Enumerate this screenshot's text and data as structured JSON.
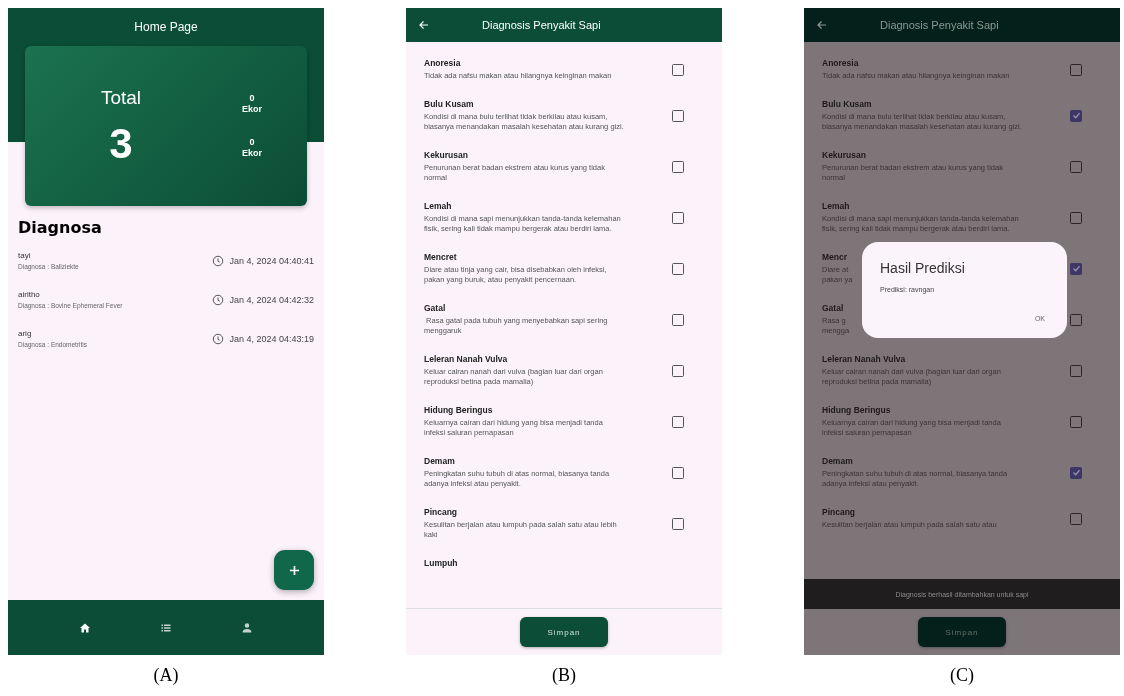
{
  "home_screen": {
    "title": "Home Page",
    "total_label": "Total",
    "total_value": "3",
    "stats": [
      {
        "value": "0",
        "unit": "Ekor"
      },
      {
        "value": "0",
        "unit": "Ekor"
      }
    ],
    "section_title": "Diagnosa",
    "diagnoses": [
      {
        "name": "tayi",
        "diagnosis": "Diagnosa : Ballziekte",
        "time": "Jan 4, 2024 04:40:41"
      },
      {
        "name": "airitho",
        "diagnosis": "Diagnosa : Bovine Ephemeral Fever",
        "time": "Jan 4, 2024 04:42:32"
      },
      {
        "name": "arig",
        "diagnosis": "Diagnosa : Endometritis",
        "time": "Jan 4, 2024 04:43:19"
      }
    ],
    "nav": [
      {
        "kind": "home",
        "selected": true
      },
      {
        "kind": "list",
        "selected": false
      },
      {
        "kind": "person",
        "selected": false
      }
    ]
  },
  "diagnosis_screen": {
    "title": "Diagnosis Penyakit Sapi",
    "symptoms": [
      {
        "title": "Anoresia",
        "desc": "Tidak ada nafsu makan atau hilangnya keinginan makan",
        "checked": false
      },
      {
        "title": "Bulu Kusam",
        "desc": "Kondisi di mana bulu terlihat tidak berkilau atau kusam, biasanya menandakan masalah kesehatan atau kurang gizi.",
        "checked": false
      },
      {
        "title": "Kekurusan",
        "desc": "Penurunan berat badan ekstrem atau kurus yang tidak normal",
        "checked": false
      },
      {
        "title": "Lemah",
        "desc": "Kondisi di mana sapi menunjukkan tanda-tanda kelemahan fisik, sering kali tidak mampu bergerak atau berdiri lama.",
        "checked": false
      },
      {
        "title": "Mencret",
        "desc": "Diare atau tinja yang cair, bisa disebabkan oleh infeksi, pakan yang buruk, atau penyakit pencernaan.",
        "checked": false
      },
      {
        "title": "Gatal",
        "desc": " Rasa gatal pada tubuh yang menyebabkan sapi sering menggaruk",
        "checked": false
      },
      {
        "title": "Leleran Nanah Vulva",
        "desc": "Keluar cairan nanah dari vulva (bagian luar dari organ reproduksi betina pada mamalia)",
        "checked": false
      },
      {
        "title": "Hidung Beringus",
        "desc": "Keluarnya cairan dari hidung yang bisa menjadi tanda infeksi saluran pernapasan",
        "checked": false
      },
      {
        "title": "Demam",
        "desc": "Peningkatan suhu tubuh di atas normal, biasanya tanda adanya infeksi atau penyakit.",
        "checked": false
      },
      {
        "title": "Pincang",
        "desc": "Kesulitan berjalan atau lumpuh pada salah satu atau lebih kaki",
        "checked": false
      },
      {
        "title": "Lumpuh"
      }
    ],
    "button": "Simpan"
  },
  "result_screen": {
    "title": "Diagnosis Penyakit Sapi",
    "symptoms": [
      {
        "title": "Anoresia",
        "desc": "Tidak ada nafsu makan atau hilangnya keinginan makan",
        "checked": false,
        "covered": false
      },
      {
        "title": "Bulu Kusam",
        "desc": "Kondisi di mana bulu terlihat tidak berkilau atau kusam, biasanya menandakan masalah kesehatan atau kurang gizi.",
        "checked": true,
        "covered": false
      },
      {
        "title": "Kekurusan",
        "desc": "Penurunan berat badan ekstrem atau kurus yang tidak normal",
        "checked": false,
        "covered": false
      },
      {
        "title": "Lemah",
        "desc": "Kondisi di mana sapi menunjukkan tanda-tanda kelemahan fisik, sering kali tidak mampu bergerak atau berdiri lama.",
        "checked": false,
        "covered": false
      },
      {
        "title": "Mencr",
        "desc": "Diare at pakan ya",
        "checked": true,
        "covered": true
      },
      {
        "title": "Gatal",
        "desc": "Rasa g mengga",
        "checked": false,
        "covered": true
      },
      {
        "title": "Leleran Nanah Vulva",
        "desc": "Keluar cairan nanah dari vulva (bagian luar dari organ reproduksi betina pada mamalia)",
        "checked": false,
        "covered": false
      },
      {
        "title": "Hidung Beringus",
        "desc": "Keluarnya cairan dari hidung yang bisa menjadi tanda infeksi saluran pernapasan",
        "checked": false,
        "covered": false
      },
      {
        "title": "Demam",
        "desc": "Peningkatan suhu tubuh di atas normal, biasanya tanda adanya infeksi atau penyakit.",
        "checked": true,
        "covered": false
      },
      {
        "title": "Pincang",
        "desc": "Kesulitan berjalan atau lumpuh pada salah satu atau",
        "checked": false,
        "covered": false
      }
    ],
    "dialog": {
      "title": "Hasil Prediksi",
      "message": "Prediksi: ravngan",
      "button": "OK"
    },
    "snackbar": "Diagnosis berhasil ditambahkan untuk sapi",
    "button": "Simpan"
  },
  "captions": [
    "(A)",
    "(B)",
    "(C)"
  ]
}
